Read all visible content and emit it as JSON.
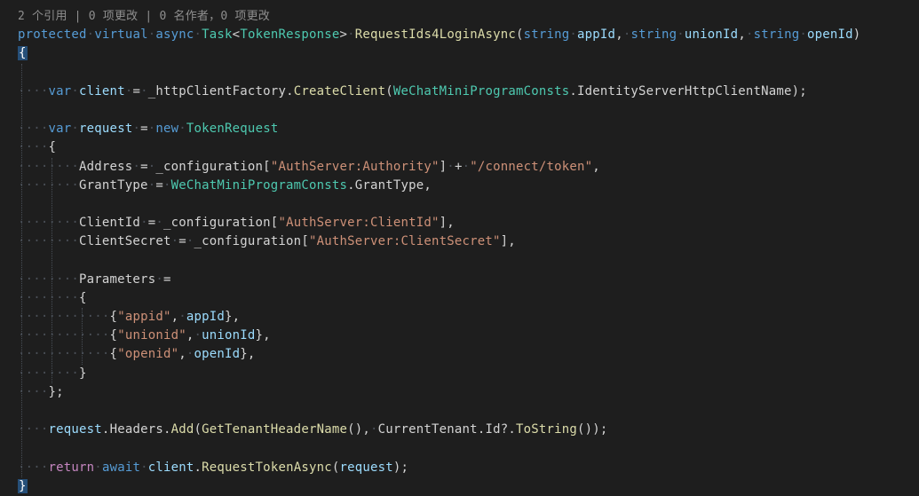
{
  "editor": {
    "codelens": "2 个引用 | 0 项更改 | 0 名作者，0 项更改",
    "colors": {
      "background": "#1E1E1E",
      "keyword": "#569CD6",
      "control_keyword": "#C586C0",
      "type": "#4EC9B0",
      "method": "#DCDCAA",
      "string": "#CE9178",
      "variable": "#9CDCFE",
      "text": "#D4D4D4",
      "whitespace_dot": "#4A4F57",
      "codelens": "#8F8F8F",
      "brace_match_background": "#264F78",
      "indent_guide": "#474D55"
    },
    "code_lines": [
      {
        "tokens": [
          [
            "kw",
            "protected"
          ],
          [
            "ws",
            " "
          ],
          [
            "kw",
            "virtual"
          ],
          [
            "ws",
            " "
          ],
          [
            "kw",
            "async"
          ],
          [
            "ws",
            " "
          ],
          [
            "type",
            "Task"
          ],
          [
            "punct",
            "<"
          ],
          [
            "type",
            "TokenResponse"
          ],
          [
            "punct",
            ">"
          ],
          [
            "ws",
            " "
          ],
          [
            "method",
            "RequestIds4LoginAsync"
          ],
          [
            "punct",
            "("
          ],
          [
            "kw",
            "string"
          ],
          [
            "ws",
            " "
          ],
          [
            "var",
            "appId"
          ],
          [
            "punct",
            ","
          ],
          [
            "ws",
            " "
          ],
          [
            "kw",
            "string"
          ],
          [
            "ws",
            " "
          ],
          [
            "var",
            "unionId"
          ],
          [
            "punct",
            ","
          ],
          [
            "ws",
            " "
          ],
          [
            "kw",
            "string"
          ],
          [
            "ws",
            " "
          ],
          [
            "var",
            "openId"
          ],
          [
            "punct",
            ")"
          ]
        ]
      },
      {
        "tokens": [
          [
            "brace",
            "{"
          ]
        ]
      },
      {
        "tokens": []
      },
      {
        "tokens": [
          [
            "ws",
            "    "
          ],
          [
            "kw",
            "var"
          ],
          [
            "ws",
            " "
          ],
          [
            "var",
            "client"
          ],
          [
            "ws",
            " "
          ],
          [
            "punct",
            "="
          ],
          [
            "ws",
            " "
          ],
          [
            "plain",
            "_httpClientFactory"
          ],
          [
            "punct",
            "."
          ],
          [
            "method",
            "CreateClient"
          ],
          [
            "punct",
            "("
          ],
          [
            "type",
            "WeChatMiniProgramConsts"
          ],
          [
            "punct",
            "."
          ],
          [
            "plain",
            "IdentityServerHttpClientName"
          ],
          [
            "punct",
            ");"
          ]
        ]
      },
      {
        "tokens": []
      },
      {
        "tokens": [
          [
            "ws",
            "    "
          ],
          [
            "kw",
            "var"
          ],
          [
            "ws",
            " "
          ],
          [
            "var",
            "request"
          ],
          [
            "ws",
            " "
          ],
          [
            "punct",
            "="
          ],
          [
            "ws",
            " "
          ],
          [
            "kw",
            "new"
          ],
          [
            "ws",
            " "
          ],
          [
            "type",
            "TokenRequest"
          ]
        ]
      },
      {
        "tokens": [
          [
            "ws",
            "    "
          ],
          [
            "punct",
            "{"
          ]
        ]
      },
      {
        "tokens": [
          [
            "ws",
            "        "
          ],
          [
            "plain",
            "Address"
          ],
          [
            "ws",
            " "
          ],
          [
            "punct",
            "="
          ],
          [
            "ws",
            " "
          ],
          [
            "plain",
            "_configuration"
          ],
          [
            "punct",
            "["
          ],
          [
            "str",
            "\"AuthServer:Authority\""
          ],
          [
            "punct",
            "]"
          ],
          [
            "ws",
            " "
          ],
          [
            "punct",
            "+"
          ],
          [
            "ws",
            " "
          ],
          [
            "str",
            "\"/connect/token\""
          ],
          [
            "punct",
            ","
          ]
        ]
      },
      {
        "tokens": [
          [
            "ws",
            "        "
          ],
          [
            "plain",
            "GrantType"
          ],
          [
            "ws",
            " "
          ],
          [
            "punct",
            "="
          ],
          [
            "ws",
            " "
          ],
          [
            "type",
            "WeChatMiniProgramConsts"
          ],
          [
            "punct",
            "."
          ],
          [
            "plain",
            "GrantType"
          ],
          [
            "punct",
            ","
          ]
        ]
      },
      {
        "tokens": []
      },
      {
        "tokens": [
          [
            "ws",
            "        "
          ],
          [
            "plain",
            "ClientId"
          ],
          [
            "ws",
            " "
          ],
          [
            "punct",
            "="
          ],
          [
            "ws",
            " "
          ],
          [
            "plain",
            "_configuration"
          ],
          [
            "punct",
            "["
          ],
          [
            "str",
            "\"AuthServer:ClientId\""
          ],
          [
            "punct",
            "],"
          ]
        ]
      },
      {
        "tokens": [
          [
            "ws",
            "        "
          ],
          [
            "plain",
            "ClientSecret"
          ],
          [
            "ws",
            " "
          ],
          [
            "punct",
            "="
          ],
          [
            "ws",
            " "
          ],
          [
            "plain",
            "_configuration"
          ],
          [
            "punct",
            "["
          ],
          [
            "str",
            "\"AuthServer:ClientSecret\""
          ],
          [
            "punct",
            "],"
          ]
        ]
      },
      {
        "tokens": []
      },
      {
        "tokens": [
          [
            "ws",
            "        "
          ],
          [
            "plain",
            "Parameters"
          ],
          [
            "ws",
            " "
          ],
          [
            "punct",
            "="
          ]
        ]
      },
      {
        "tokens": [
          [
            "ws",
            "        "
          ],
          [
            "punct",
            "{"
          ]
        ]
      },
      {
        "tokens": [
          [
            "ws",
            "            "
          ],
          [
            "punct",
            "{"
          ],
          [
            "str",
            "\"appid\""
          ],
          [
            "punct",
            ","
          ],
          [
            "ws",
            " "
          ],
          [
            "var",
            "appId"
          ],
          [
            "punct",
            "},"
          ]
        ]
      },
      {
        "tokens": [
          [
            "ws",
            "            "
          ],
          [
            "punct",
            "{"
          ],
          [
            "str",
            "\"unionid\""
          ],
          [
            "punct",
            ","
          ],
          [
            "ws",
            " "
          ],
          [
            "var",
            "unionId"
          ],
          [
            "punct",
            "},"
          ]
        ]
      },
      {
        "tokens": [
          [
            "ws",
            "            "
          ],
          [
            "punct",
            "{"
          ],
          [
            "str",
            "\"openid\""
          ],
          [
            "punct",
            ","
          ],
          [
            "ws",
            " "
          ],
          [
            "var",
            "openId"
          ],
          [
            "punct",
            "},"
          ]
        ]
      },
      {
        "tokens": [
          [
            "ws",
            "        "
          ],
          [
            "punct",
            "}"
          ]
        ]
      },
      {
        "tokens": [
          [
            "ws",
            "    "
          ],
          [
            "punct",
            "};"
          ]
        ]
      },
      {
        "tokens": []
      },
      {
        "tokens": [
          [
            "ws",
            "    "
          ],
          [
            "var",
            "request"
          ],
          [
            "punct",
            "."
          ],
          [
            "plain",
            "Headers"
          ],
          [
            "punct",
            "."
          ],
          [
            "method",
            "Add"
          ],
          [
            "punct",
            "("
          ],
          [
            "method",
            "GetTenantHeaderName"
          ],
          [
            "punct",
            "(),"
          ],
          [
            "ws",
            " "
          ],
          [
            "plain",
            "CurrentTenant"
          ],
          [
            "punct",
            "."
          ],
          [
            "plain",
            "Id"
          ],
          [
            "punct",
            "?."
          ],
          [
            "method",
            "ToString"
          ],
          [
            "punct",
            "());"
          ]
        ]
      },
      {
        "tokens": []
      },
      {
        "tokens": [
          [
            "ws",
            "    "
          ],
          [
            "ret",
            "return"
          ],
          [
            "ws",
            " "
          ],
          [
            "kw",
            "await"
          ],
          [
            "ws",
            " "
          ],
          [
            "var",
            "client"
          ],
          [
            "punct",
            "."
          ],
          [
            "method",
            "RequestTokenAsync"
          ],
          [
            "punct",
            "("
          ],
          [
            "var",
            "request"
          ],
          [
            "punct",
            ");"
          ]
        ]
      },
      {
        "tokens": [
          [
            "brace",
            "}"
          ]
        ]
      }
    ]
  }
}
